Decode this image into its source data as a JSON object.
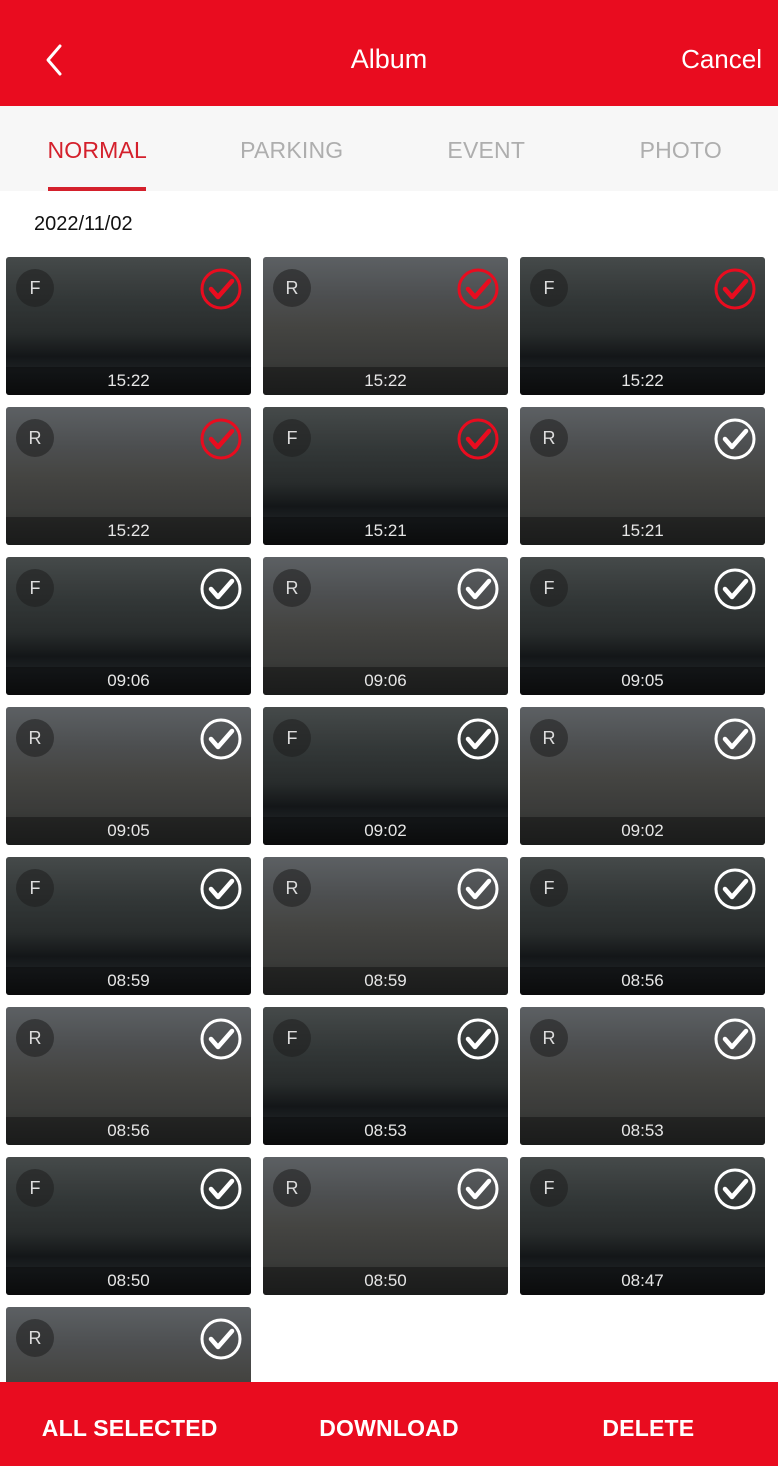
{
  "header": {
    "title": "Album",
    "cancel_label": "Cancel",
    "back_icon": "chevron-left-icon",
    "color": "#E90C1F"
  },
  "tabs": [
    {
      "label": "NORMAL",
      "active": true
    },
    {
      "label": "PARKING",
      "active": false
    },
    {
      "label": "EVENT",
      "active": false
    },
    {
      "label": "PHOTO",
      "active": false
    }
  ],
  "accent_color": "#D4202C",
  "date_group": "2022/11/02",
  "clips": [
    {
      "camera": "F",
      "time": "15:22",
      "selected": true
    },
    {
      "camera": "R",
      "time": "15:22",
      "selected": true
    },
    {
      "camera": "F",
      "time": "15:22",
      "selected": true
    },
    {
      "camera": "R",
      "time": "15:22",
      "selected": true
    },
    {
      "camera": "F",
      "time": "15:21",
      "selected": true
    },
    {
      "camera": "R",
      "time": "15:21",
      "selected": false
    },
    {
      "camera": "F",
      "time": "09:06",
      "selected": false
    },
    {
      "camera": "R",
      "time": "09:06",
      "selected": false
    },
    {
      "camera": "F",
      "time": "09:05",
      "selected": false
    },
    {
      "camera": "R",
      "time": "09:05",
      "selected": false
    },
    {
      "camera": "F",
      "time": "09:02",
      "selected": false
    },
    {
      "camera": "R",
      "time": "09:02",
      "selected": false
    },
    {
      "camera": "F",
      "time": "08:59",
      "selected": false
    },
    {
      "camera": "R",
      "time": "08:59",
      "selected": false
    },
    {
      "camera": "F",
      "time": "08:56",
      "selected": false
    },
    {
      "camera": "R",
      "time": "08:56",
      "selected": false
    },
    {
      "camera": "F",
      "time": "08:53",
      "selected": false
    },
    {
      "camera": "R",
      "time": "08:53",
      "selected": false
    },
    {
      "camera": "F",
      "time": "08:50",
      "selected": false
    },
    {
      "camera": "R",
      "time": "08:50",
      "selected": false
    },
    {
      "camera": "F",
      "time": "08:47",
      "selected": false
    },
    {
      "camera": "R",
      "time": "",
      "selected": false
    }
  ],
  "bottom_bar": {
    "all_selected_label": "ALL SELECTED",
    "download_label": "DOWNLOAD",
    "delete_label": "DELETE"
  }
}
